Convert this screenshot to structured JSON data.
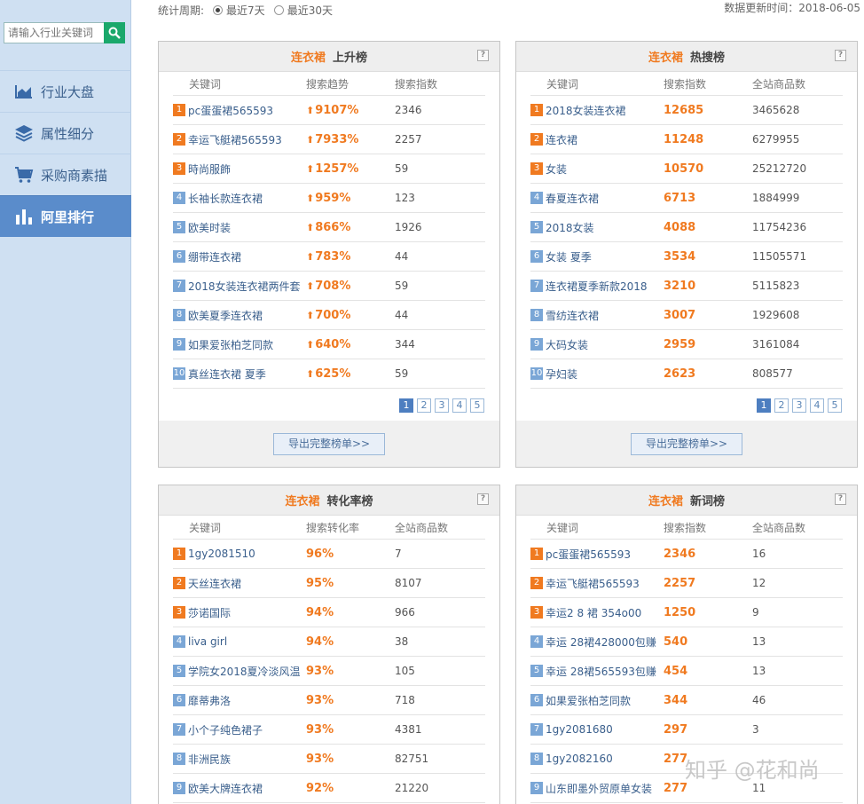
{
  "sidebar": {
    "search_placeholder": "请输入行业关键词",
    "items": [
      {
        "label": "行业大盘",
        "icon": "area-chart-icon"
      },
      {
        "label": "属性细分",
        "icon": "layers-icon"
      },
      {
        "label": "采购商素描",
        "icon": "cart-icon"
      },
      {
        "label": "阿里排行",
        "icon": "bar-chart-icon",
        "active": true
      }
    ]
  },
  "topbar": {
    "period_label": "统计周期:",
    "options": [
      "最近7天",
      "最近30天"
    ],
    "selected": "最近7天",
    "update_text": "数据更新时间：2018-06-05"
  },
  "panels": [
    {
      "category": "连衣裙",
      "title": "上升榜",
      "columns": [
        "关键词",
        "搜索趋势",
        "搜索指数"
      ],
      "rows": [
        {
          "rank": "1",
          "kw": "pc蛋蛋裙565593",
          "v": "9107%",
          "n": "2346"
        },
        {
          "rank": "2",
          "kw": "幸运飞艇裙565593",
          "v": "7933%",
          "n": "2257"
        },
        {
          "rank": "3",
          "kw": "時尚服飾",
          "v": "1257%",
          "n": "59"
        },
        {
          "rank": "4",
          "kw": "长袖长款连衣裙",
          "v": "959%",
          "n": "123"
        },
        {
          "rank": "5",
          "kw": "欧美时装",
          "v": "866%",
          "n": "1926"
        },
        {
          "rank": "6",
          "kw": "绷带连衣裙",
          "v": "783%",
          "n": "44"
        },
        {
          "rank": "7",
          "kw": "2018女装连衣裙两件套",
          "v": "708%",
          "n": "59"
        },
        {
          "rank": "8",
          "kw": "欧美夏季连衣裙",
          "v": "700%",
          "n": "44"
        },
        {
          "rank": "9",
          "kw": "如果爱张柏芝同款",
          "v": "640%",
          "n": "344"
        },
        {
          "rank": "10",
          "kw": "真丝连衣裙 夏季",
          "v": "625%",
          "n": "59"
        }
      ],
      "pages": [
        "1",
        "2",
        "3",
        "4",
        "5"
      ],
      "export_label": "导出完整榜单>>"
    },
    {
      "category": "连衣裙",
      "title": "热搜榜",
      "columns": [
        "关键词",
        "搜索指数",
        "全站商品数"
      ],
      "rows": [
        {
          "rank": "1",
          "kw": "2018女装连衣裙",
          "v": "12685",
          "n": "3465628"
        },
        {
          "rank": "2",
          "kw": "连衣裙",
          "v": "11248",
          "n": "6279955"
        },
        {
          "rank": "3",
          "kw": "女装",
          "v": "10570",
          "n": "25212720"
        },
        {
          "rank": "4",
          "kw": "春夏连衣裙",
          "v": "6713",
          "n": "1884999"
        },
        {
          "rank": "5",
          "kw": "2018女装",
          "v": "4088",
          "n": "11754236"
        },
        {
          "rank": "6",
          "kw": "女装 夏季",
          "v": "3534",
          "n": "11505571"
        },
        {
          "rank": "7",
          "kw": "连衣裙夏季新款2018",
          "v": "3210",
          "n": "5115823"
        },
        {
          "rank": "8",
          "kw": "雪纺连衣裙",
          "v": "3007",
          "n": "1929608"
        },
        {
          "rank": "9",
          "kw": "大码女装",
          "v": "2959",
          "n": "3161084"
        },
        {
          "rank": "10",
          "kw": "孕妇装",
          "v": "2623",
          "n": "808577"
        }
      ],
      "pages": [
        "1",
        "2",
        "3",
        "4",
        "5"
      ],
      "export_label": "导出完整榜单>>"
    },
    {
      "category": "连衣裙",
      "title": "转化率榜",
      "columns": [
        "关键词",
        "搜索转化率",
        "全站商品数"
      ],
      "rows": [
        {
          "rank": "1",
          "kw": "1gy2081510",
          "v": "96%",
          "n": "7"
        },
        {
          "rank": "2",
          "kw": "天丝连衣裙",
          "v": "95%",
          "n": "8107"
        },
        {
          "rank": "3",
          "kw": "莎诺国际",
          "v": "94%",
          "n": "966"
        },
        {
          "rank": "4",
          "kw": "liva girl",
          "v": "94%",
          "n": "38"
        },
        {
          "rank": "5",
          "kw": "学院女2018夏冷淡风温",
          "v": "93%",
          "n": "105"
        },
        {
          "rank": "6",
          "kw": "靡蒂弗洛",
          "v": "93%",
          "n": "718"
        },
        {
          "rank": "7",
          "kw": "小个子纯色裙子",
          "v": "93%",
          "n": "4381"
        },
        {
          "rank": "8",
          "kw": "非洲民族",
          "v": "93%",
          "n": "82751"
        },
        {
          "rank": "9",
          "kw": "欧美大牌连衣裙",
          "v": "92%",
          "n": "21220"
        }
      ]
    },
    {
      "category": "连衣裙",
      "title": "新词榜",
      "columns": [
        "关键词",
        "搜索指数",
        "全站商品数"
      ],
      "rows": [
        {
          "rank": "1",
          "kw": "pc蛋蛋裙565593",
          "v": "2346",
          "n": "16"
        },
        {
          "rank": "2",
          "kw": "幸运飞艇裙565593",
          "v": "2257",
          "n": "12"
        },
        {
          "rank": "3",
          "kw": "幸运2 8 裙 354o00",
          "v": "1250",
          "n": "9"
        },
        {
          "rank": "4",
          "kw": "幸运 28裙428000包赚",
          "v": "540",
          "n": "13"
        },
        {
          "rank": "5",
          "kw": "幸运 28裙565593包赚",
          "v": "454",
          "n": "13"
        },
        {
          "rank": "6",
          "kw": "如果爱张柏芝同款",
          "v": "344",
          "n": "46"
        },
        {
          "rank": "7",
          "kw": "1gy2081680",
          "v": "297",
          "n": "3"
        },
        {
          "rank": "8",
          "kw": "1gy2082160",
          "v": "277",
          "n": ""
        },
        {
          "rank": "9",
          "kw": "山东即墨外贸原单女装",
          "v": "277",
          "n": "11"
        }
      ]
    }
  ],
  "watermark": "知乎 @花和尚"
}
